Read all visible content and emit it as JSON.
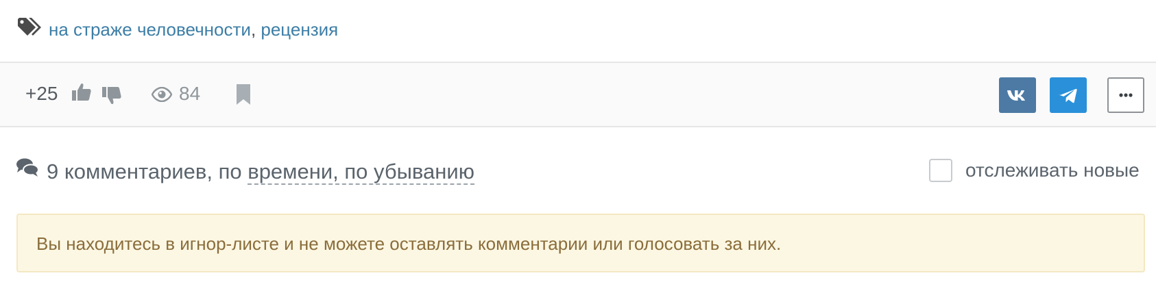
{
  "tags": {
    "icon": "tags-icon",
    "items": [
      "на страже человечности",
      "рецензия"
    ],
    "separator": ", "
  },
  "post_actions": {
    "rating": "+25",
    "upvote_icon": "thumbs-up-icon",
    "downvote_icon": "thumbs-down-icon",
    "views_icon": "eye-icon",
    "views": "84",
    "bookmark_icon": "bookmark-icon",
    "share": {
      "vk_icon": "vk-icon",
      "telegram_icon": "telegram-icon",
      "more_icon": "more-icon"
    }
  },
  "comments": {
    "icon": "comments-icon",
    "count_label": "9 комментариев, по ",
    "sort_label": "времени, по убыванию",
    "track_label": "отслеживать новые",
    "track_checked": false
  },
  "notice": {
    "text": "Вы находитесь в игнор-листе и не можете оставлять комментарии или голосовать за них."
  },
  "colors": {
    "link": "#3d7ea6",
    "vk": "#4c7aa4",
    "telegram": "#2a90d9",
    "notice_bg": "#fcf7e3",
    "notice_text": "#8a6d3b"
  }
}
